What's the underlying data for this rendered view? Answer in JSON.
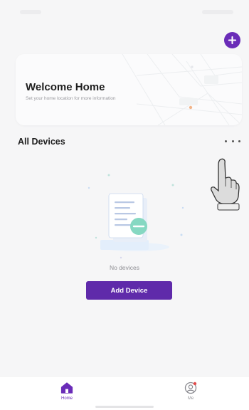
{
  "header": {
    "add_icon": "plus-icon"
  },
  "welcome_card": {
    "title": "Welcome Home",
    "subtitle": "Set your home location for more information"
  },
  "devices": {
    "section_title": "All Devices",
    "more_icon": "more-horizontal-icon",
    "empty_text": "No devices",
    "add_button_label": "Add Device"
  },
  "tab_bar": {
    "items": [
      {
        "label": "Home",
        "icon": "home-icon",
        "active": true
      },
      {
        "label": "Me",
        "icon": "user-circle-icon",
        "active": false
      }
    ]
  },
  "colors": {
    "accent": "#6a2cb8",
    "button": "#5f2aaa",
    "background": "#f6f6f7"
  }
}
